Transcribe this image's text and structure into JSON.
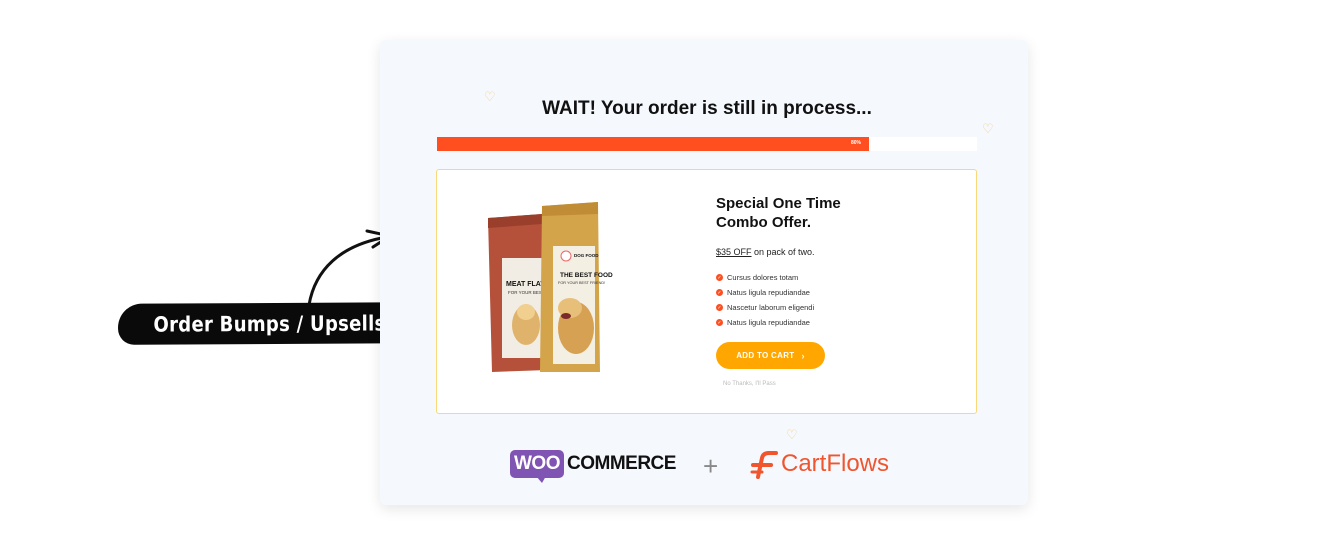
{
  "annotation": {
    "label": "Order Bumps / Upsells"
  },
  "page": {
    "heading": "WAIT! Your order is still in process..."
  },
  "progress": {
    "value_percent": 80,
    "label": "80%"
  },
  "offer": {
    "title_line1": "Special One Time",
    "title_line2": "Combo Offer.",
    "discount": "$35 OFF",
    "discount_suffix": " on pack of two.",
    "features": [
      "Cursus dolores totam",
      "Natus ligula repudiandae",
      "Nascetur laborum eligendi",
      "Natus ligula repudiandae"
    ],
    "cta_label": "ADD TO CART",
    "decline_label": "No Thanks, I'll Pass",
    "product": {
      "back_bag_text": "MEAT FLAVO",
      "back_bag_subtext": "FOR YOUR BEST",
      "front_bag_brand": "DOG FOOD",
      "front_bag_text": "THE BEST FOOD",
      "front_bag_subtext": "FOR YOUR BEST FRIEND!"
    }
  },
  "logos": {
    "woo_badge": "WOO",
    "woo_text": "COMMERCE",
    "plus": "+",
    "cartflows": "CartFlows"
  },
  "colors": {
    "accent": "#ff4e1f",
    "cta": "#ffa700",
    "woo": "#7f54b3",
    "cartflows": "#f0552e",
    "heart": "#f6cf8a",
    "offer_border": "#f8d878"
  },
  "icons": [
    "heart-icon",
    "check-icon",
    "chevron-right-icon",
    "arrow-icon",
    "cartflows-logo-icon"
  ]
}
